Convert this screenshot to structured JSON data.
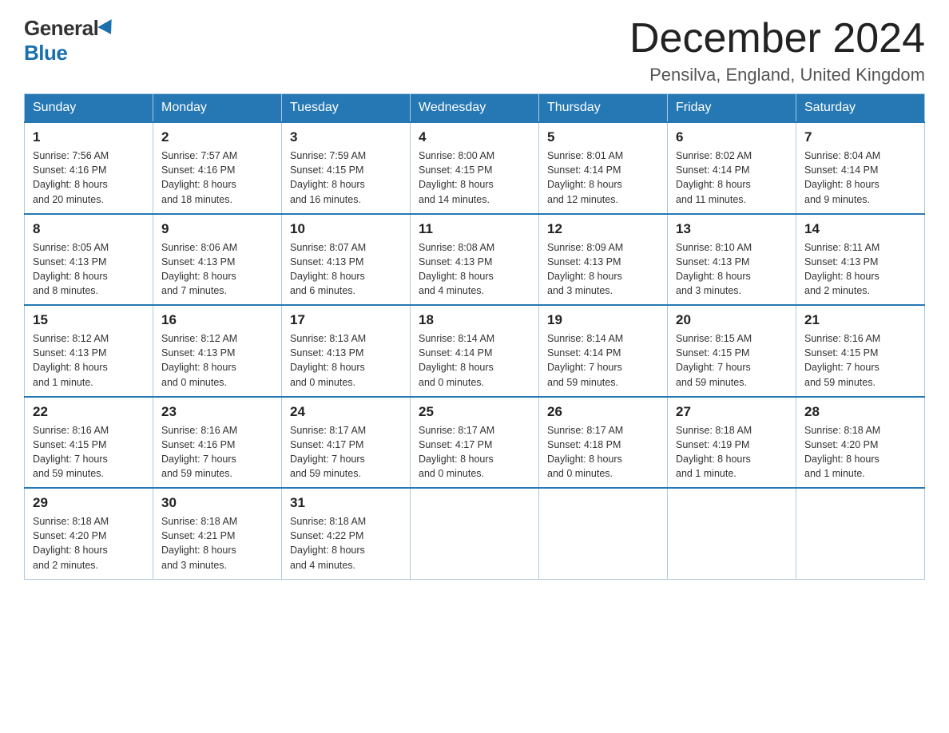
{
  "header": {
    "logo_general": "General",
    "logo_blue": "Blue",
    "month_title": "December 2024",
    "location": "Pensilva, England, United Kingdom"
  },
  "days_of_week": [
    "Sunday",
    "Monday",
    "Tuesday",
    "Wednesday",
    "Thursday",
    "Friday",
    "Saturday"
  ],
  "weeks": [
    [
      {
        "day": "1",
        "sunrise": "7:56 AM",
        "sunset": "4:16 PM",
        "daylight": "8 hours and 20 minutes."
      },
      {
        "day": "2",
        "sunrise": "7:57 AM",
        "sunset": "4:16 PM",
        "daylight": "8 hours and 18 minutes."
      },
      {
        "day": "3",
        "sunrise": "7:59 AM",
        "sunset": "4:15 PM",
        "daylight": "8 hours and 16 minutes."
      },
      {
        "day": "4",
        "sunrise": "8:00 AM",
        "sunset": "4:15 PM",
        "daylight": "8 hours and 14 minutes."
      },
      {
        "day": "5",
        "sunrise": "8:01 AM",
        "sunset": "4:14 PM",
        "daylight": "8 hours and 12 minutes."
      },
      {
        "day": "6",
        "sunrise": "8:02 AM",
        "sunset": "4:14 PM",
        "daylight": "8 hours and 11 minutes."
      },
      {
        "day": "7",
        "sunrise": "8:04 AM",
        "sunset": "4:14 PM",
        "daylight": "8 hours and 9 minutes."
      }
    ],
    [
      {
        "day": "8",
        "sunrise": "8:05 AM",
        "sunset": "4:13 PM",
        "daylight": "8 hours and 8 minutes."
      },
      {
        "day": "9",
        "sunrise": "8:06 AM",
        "sunset": "4:13 PM",
        "daylight": "8 hours and 7 minutes."
      },
      {
        "day": "10",
        "sunrise": "8:07 AM",
        "sunset": "4:13 PM",
        "daylight": "8 hours and 6 minutes."
      },
      {
        "day": "11",
        "sunrise": "8:08 AM",
        "sunset": "4:13 PM",
        "daylight": "8 hours and 4 minutes."
      },
      {
        "day": "12",
        "sunrise": "8:09 AM",
        "sunset": "4:13 PM",
        "daylight": "8 hours and 3 minutes."
      },
      {
        "day": "13",
        "sunrise": "8:10 AM",
        "sunset": "4:13 PM",
        "daylight": "8 hours and 3 minutes."
      },
      {
        "day": "14",
        "sunrise": "8:11 AM",
        "sunset": "4:13 PM",
        "daylight": "8 hours and 2 minutes."
      }
    ],
    [
      {
        "day": "15",
        "sunrise": "8:12 AM",
        "sunset": "4:13 PM",
        "daylight": "8 hours and 1 minute."
      },
      {
        "day": "16",
        "sunrise": "8:12 AM",
        "sunset": "4:13 PM",
        "daylight": "8 hours and 0 minutes."
      },
      {
        "day": "17",
        "sunrise": "8:13 AM",
        "sunset": "4:13 PM",
        "daylight": "8 hours and 0 minutes."
      },
      {
        "day": "18",
        "sunrise": "8:14 AM",
        "sunset": "4:14 PM",
        "daylight": "8 hours and 0 minutes."
      },
      {
        "day": "19",
        "sunrise": "8:14 AM",
        "sunset": "4:14 PM",
        "daylight": "7 hours and 59 minutes."
      },
      {
        "day": "20",
        "sunrise": "8:15 AM",
        "sunset": "4:15 PM",
        "daylight": "7 hours and 59 minutes."
      },
      {
        "day": "21",
        "sunrise": "8:16 AM",
        "sunset": "4:15 PM",
        "daylight": "7 hours and 59 minutes."
      }
    ],
    [
      {
        "day": "22",
        "sunrise": "8:16 AM",
        "sunset": "4:15 PM",
        "daylight": "7 hours and 59 minutes."
      },
      {
        "day": "23",
        "sunrise": "8:16 AM",
        "sunset": "4:16 PM",
        "daylight": "7 hours and 59 minutes."
      },
      {
        "day": "24",
        "sunrise": "8:17 AM",
        "sunset": "4:17 PM",
        "daylight": "7 hours and 59 minutes."
      },
      {
        "day": "25",
        "sunrise": "8:17 AM",
        "sunset": "4:17 PM",
        "daylight": "8 hours and 0 minutes."
      },
      {
        "day": "26",
        "sunrise": "8:17 AM",
        "sunset": "4:18 PM",
        "daylight": "8 hours and 0 minutes."
      },
      {
        "day": "27",
        "sunrise": "8:18 AM",
        "sunset": "4:19 PM",
        "daylight": "8 hours and 1 minute."
      },
      {
        "day": "28",
        "sunrise": "8:18 AM",
        "sunset": "4:20 PM",
        "daylight": "8 hours and 1 minute."
      }
    ],
    [
      {
        "day": "29",
        "sunrise": "8:18 AM",
        "sunset": "4:20 PM",
        "daylight": "8 hours and 2 minutes."
      },
      {
        "day": "30",
        "sunrise": "8:18 AM",
        "sunset": "4:21 PM",
        "daylight": "8 hours and 3 minutes."
      },
      {
        "day": "31",
        "sunrise": "8:18 AM",
        "sunset": "4:22 PM",
        "daylight": "8 hours and 4 minutes."
      },
      null,
      null,
      null,
      null
    ]
  ],
  "labels": {
    "sunrise": "Sunrise:",
    "sunset": "Sunset:",
    "daylight": "Daylight:"
  }
}
